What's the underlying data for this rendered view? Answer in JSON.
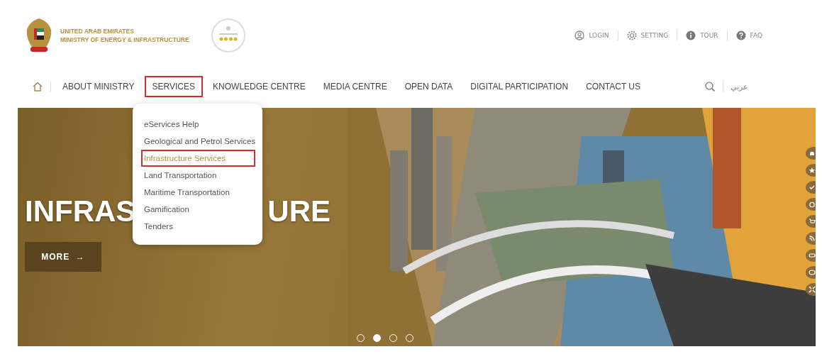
{
  "header": {
    "org_line_1": "UNITED ARAB EMIRATES",
    "org_line_2": "MINISTRY OF ENERGY & INFRASTRUCTURE",
    "utility_links": [
      {
        "label": "LOGIN",
        "kind": "user"
      },
      {
        "label": "SETTING",
        "kind": "gear"
      },
      {
        "label": "TOUR",
        "kind": "info"
      },
      {
        "label": "FAQ",
        "kind": "help"
      }
    ]
  },
  "nav": {
    "items": [
      {
        "label": "ABOUT MINISTRY",
        "selected": false
      },
      {
        "label": "SERVICES",
        "selected": true
      },
      {
        "label": "KNOWLEDGE CENTRE",
        "selected": false
      },
      {
        "label": "MEDIA CENTRE",
        "selected": false
      },
      {
        "label": "OPEN DATA",
        "selected": false
      },
      {
        "label": "DIGITAL PARTICIPATION",
        "selected": false
      },
      {
        "label": "CONTACT US",
        "selected": false
      }
    ],
    "language": "عربي"
  },
  "services_menu": [
    {
      "label": "eServices Help",
      "selected": false
    },
    {
      "label": "Geological and Petrol Services",
      "selected": false
    },
    {
      "label": "Infrastructure Services",
      "selected": true
    },
    {
      "label": "Land Transportation",
      "selected": false
    },
    {
      "label": "Maritime Transportation",
      "selected": false
    },
    {
      "label": "Gamification",
      "selected": false
    },
    {
      "label": "Tenders",
      "selected": false
    }
  ],
  "hero": {
    "title_parts": [
      "INFRAS",
      "URE"
    ],
    "button": "MORE",
    "arrow": "→",
    "dots": [
      {
        "selected": false
      },
      {
        "selected": true
      },
      {
        "selected": false
      },
      {
        "selected": false
      }
    ]
  }
}
